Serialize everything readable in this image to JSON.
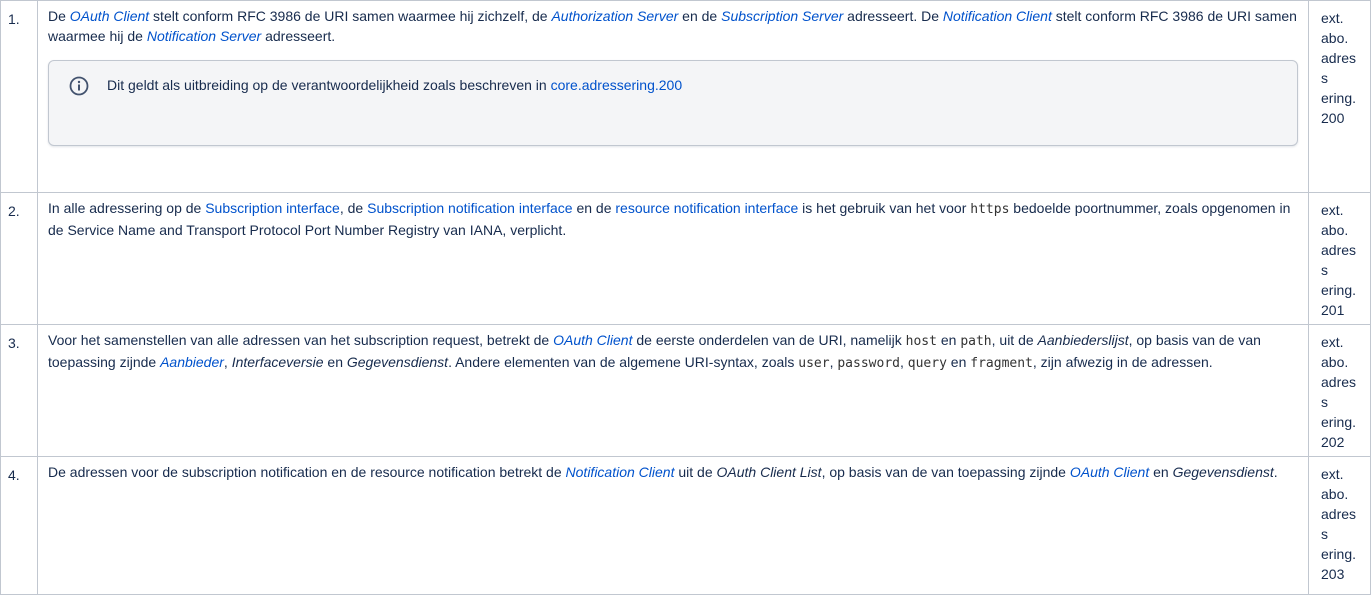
{
  "rows": [
    {
      "number": "1.",
      "text": {
        "p1_a": "De ",
        "p1_oauth_client": "OAuth Client",
        "p1_b": " stelt conform RFC 3986 de URI samen waarmee hij zichzelf, de ",
        "p1_auth_server": "Authorization Server",
        "p1_c": " en de ",
        "p1_subscription_server": "Subscription Server",
        "p1_d": " adresseert. De ",
        "p1_notification_client": "Notification Client",
        "p1_e": " stelt conform RFC 3986 de URI samen waarmee hij de ",
        "p1_notification_server": "Notification Server",
        "p1_f": " adresseert."
      },
      "info_panel": {
        "text": "Dit geldt als uitbreiding op de verantwoordelijkheid zoals beschreven in ",
        "link": "core.adressering.200"
      },
      "code": [
        "ext.",
        "abo.",
        "adress",
        "ering.",
        "200"
      ]
    },
    {
      "number": "2.",
      "text": {
        "a": "In alle adressering op de ",
        "subscription_interface": "Subscription interface",
        "b": ", de ",
        "subscription_notification_interface": "Subscription notification interface",
        "c": " en de ",
        "resource_notification_interface": "resource notification interface",
        "d": " is het gebruik van het voor ",
        "https": "https",
        "e": " bedoelde poortnummer, zoals opgenomen in de Service Name and Transport Protocol Port Number Registry van IANA, verplicht."
      },
      "code": [
        "ext.",
        "abo.",
        "adress",
        "ering.",
        "201"
      ]
    },
    {
      "number": "3.",
      "text": {
        "a": "Voor het samenstellen van alle adressen van het subscription request, betrekt de ",
        "oauth_client": "OAuth Client",
        "b": " de eerste onderdelen van de URI, namelijk ",
        "host": "host",
        "c": " en ",
        "path": "path",
        "d": ", uit de ",
        "aanbiederslijst": "Aanbiederslijst",
        "e": ", op basis van de van toepassing zijnde ",
        "aanbieder": "Aanbieder",
        "f": ", ",
        "interfaceversie": "Interfaceversie",
        "g": " en ",
        "gegevensdienst": "Gegevensdienst",
        "h": ". Andere elementen van de algemene URI-syntax, zoals ",
        "user": "user",
        "i": ", ",
        "password": "password",
        "j": ", ",
        "query": "query",
        "k": " en ",
        "fragment": "fragment",
        "l": ", zijn afwezig in de adressen."
      },
      "code": [
        "ext.",
        "abo.",
        "adress",
        "ering.",
        "202"
      ]
    },
    {
      "number": "4.",
      "text": {
        "a": "De adressen voor de subscription notification en de resource notification betrekt de ",
        "notification_client": "Notification Client",
        "b": " uit de ",
        "oauth_client_list": "OAuth Client List",
        "c": ", op basis van de van toepassing zijnde ",
        "oauth_client": "OAuth Client",
        "d": " en ",
        "gegevensdienst": "Gegevensdienst",
        "e": "."
      },
      "code": [
        "ext.",
        "abo.",
        "adress",
        "ering.",
        "203"
      ]
    }
  ],
  "colors": {
    "link": "#0052cc",
    "border": "#c1c7d0",
    "panel_bg": "#f4f5f7",
    "text": "#172b4d"
  },
  "icons": {
    "info": "info-circle-icon"
  }
}
